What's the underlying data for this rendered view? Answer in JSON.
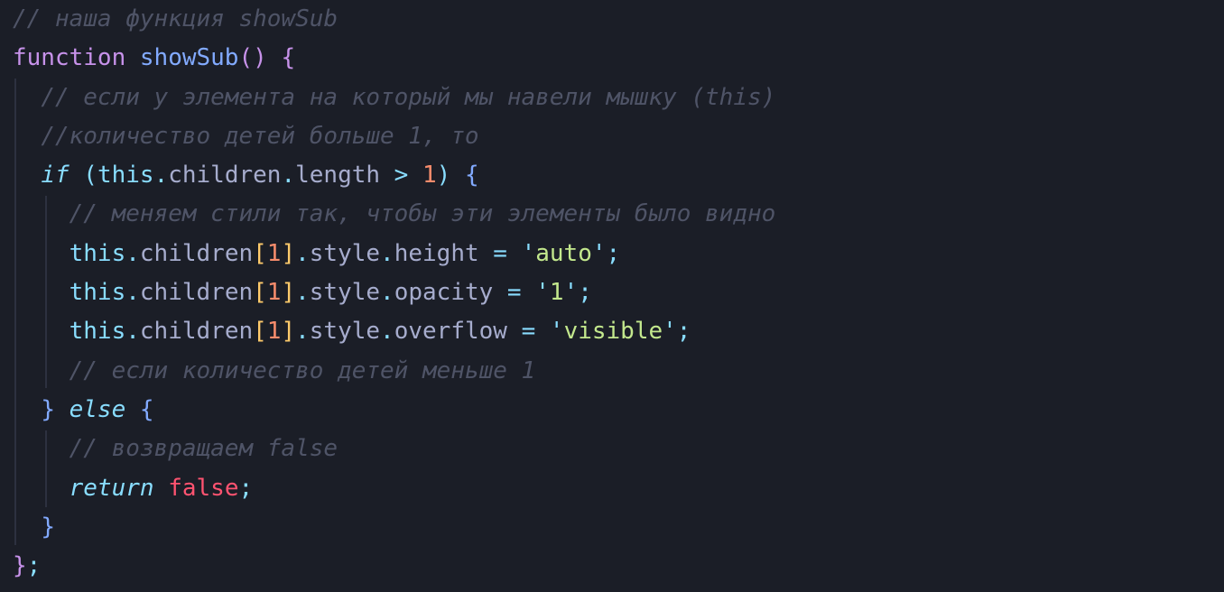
{
  "editor": {
    "language": "javascript",
    "lines": [
      [
        {
          "t": "// наша функция showSub",
          "c": "comment"
        }
      ],
      [
        {
          "t": "function",
          "c": "kw-fn"
        },
        {
          "t": " ",
          "c": "plain"
        },
        {
          "t": "showSub",
          "c": "fn"
        },
        {
          "t": "()",
          "c": "paren"
        },
        {
          "t": " ",
          "c": "plain"
        },
        {
          "t": "{",
          "c": "brace"
        }
      ],
      [
        {
          "t": "  ",
          "c": "plain"
        },
        {
          "t": "// если у элемента на который мы навели мышку (this)",
          "c": "comment"
        }
      ],
      [
        {
          "t": "  ",
          "c": "plain"
        },
        {
          "t": "//количество детей больше 1, то",
          "c": "comment"
        }
      ],
      [
        {
          "t": "  ",
          "c": "plain"
        },
        {
          "t": "if",
          "c": "kw-it"
        },
        {
          "t": " ",
          "c": "plain"
        },
        {
          "t": "(",
          "c": "punc"
        },
        {
          "t": "this",
          "c": "this"
        },
        {
          "t": ".",
          "c": "punc"
        },
        {
          "t": "children",
          "c": "prop"
        },
        {
          "t": ".",
          "c": "punc"
        },
        {
          "t": "length",
          "c": "prop"
        },
        {
          "t": " > ",
          "c": "punc"
        },
        {
          "t": "1",
          "c": "num"
        },
        {
          "t": ")",
          "c": "punc"
        },
        {
          "t": " ",
          "c": "plain"
        },
        {
          "t": "{",
          "c": "brace2"
        }
      ],
      [
        {
          "t": "    ",
          "c": "plain"
        },
        {
          "t": "// меняем стили так, чтобы эти элементы было видно",
          "c": "comment"
        }
      ],
      [
        {
          "t": "    ",
          "c": "plain"
        },
        {
          "t": "this",
          "c": "this"
        },
        {
          "t": ".",
          "c": "punc"
        },
        {
          "t": "children",
          "c": "prop"
        },
        {
          "t": "[",
          "c": "bracket"
        },
        {
          "t": "1",
          "c": "num"
        },
        {
          "t": "]",
          "c": "bracket"
        },
        {
          "t": ".",
          "c": "punc"
        },
        {
          "t": "style",
          "c": "prop"
        },
        {
          "t": ".",
          "c": "punc"
        },
        {
          "t": "height",
          "c": "prop"
        },
        {
          "t": " = ",
          "c": "punc"
        },
        {
          "t": "'",
          "c": "quote"
        },
        {
          "t": "auto",
          "c": "str"
        },
        {
          "t": "'",
          "c": "quote"
        },
        {
          "t": ";",
          "c": "punc"
        }
      ],
      [
        {
          "t": "    ",
          "c": "plain"
        },
        {
          "t": "this",
          "c": "this"
        },
        {
          "t": ".",
          "c": "punc"
        },
        {
          "t": "children",
          "c": "prop"
        },
        {
          "t": "[",
          "c": "bracket"
        },
        {
          "t": "1",
          "c": "num"
        },
        {
          "t": "]",
          "c": "bracket"
        },
        {
          "t": ".",
          "c": "punc"
        },
        {
          "t": "style",
          "c": "prop"
        },
        {
          "t": ".",
          "c": "punc"
        },
        {
          "t": "opacity",
          "c": "prop"
        },
        {
          "t": " = ",
          "c": "punc"
        },
        {
          "t": "'",
          "c": "quote"
        },
        {
          "t": "1",
          "c": "str"
        },
        {
          "t": "'",
          "c": "quote"
        },
        {
          "t": ";",
          "c": "punc"
        }
      ],
      [
        {
          "t": "    ",
          "c": "plain"
        },
        {
          "t": "this",
          "c": "this"
        },
        {
          "t": ".",
          "c": "punc"
        },
        {
          "t": "children",
          "c": "prop"
        },
        {
          "t": "[",
          "c": "bracket"
        },
        {
          "t": "1",
          "c": "num"
        },
        {
          "t": "]",
          "c": "bracket"
        },
        {
          "t": ".",
          "c": "punc"
        },
        {
          "t": "style",
          "c": "prop"
        },
        {
          "t": ".",
          "c": "punc"
        },
        {
          "t": "overflow",
          "c": "prop"
        },
        {
          "t": " = ",
          "c": "punc"
        },
        {
          "t": "'",
          "c": "quote"
        },
        {
          "t": "visible",
          "c": "str"
        },
        {
          "t": "'",
          "c": "quote"
        },
        {
          "t": ";",
          "c": "punc"
        }
      ],
      [
        {
          "t": "    ",
          "c": "plain"
        },
        {
          "t": "// если количество детей меньше 1",
          "c": "comment"
        }
      ],
      [
        {
          "t": "  ",
          "c": "plain"
        },
        {
          "t": "}",
          "c": "brace2"
        },
        {
          "t": " ",
          "c": "plain"
        },
        {
          "t": "else",
          "c": "kw-it"
        },
        {
          "t": " ",
          "c": "plain"
        },
        {
          "t": "{",
          "c": "brace2"
        }
      ],
      [
        {
          "t": "    ",
          "c": "plain"
        },
        {
          "t": "// возвращаем false",
          "c": "comment"
        }
      ],
      [
        {
          "t": "    ",
          "c": "plain"
        },
        {
          "t": "return",
          "c": "kw-it"
        },
        {
          "t": " ",
          "c": "plain"
        },
        {
          "t": "false",
          "c": "bool"
        },
        {
          "t": ";",
          "c": "punc"
        }
      ],
      [
        {
          "t": "  ",
          "c": "plain"
        },
        {
          "t": "}",
          "c": "brace2"
        }
      ],
      [
        {
          "t": "}",
          "c": "brace"
        },
        {
          "t": ";",
          "c": "punc"
        }
      ]
    ]
  }
}
